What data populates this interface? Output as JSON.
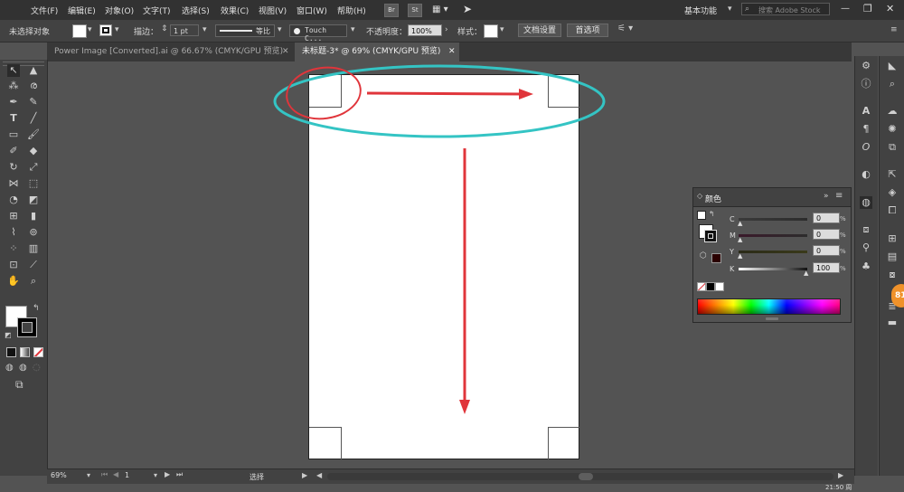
{
  "menu": [
    "文件(F)",
    "编辑(E)",
    "对象(O)",
    "文字(T)",
    "选择(S)",
    "效果(C)",
    "视图(V)",
    "窗口(W)",
    "帮助(H)"
  ],
  "menu_apps": [
    "Br",
    "St"
  ],
  "workspace": "基本功能",
  "search_placeholder": "搜索 Adobe Stock",
  "control": {
    "no_selection": "未选择对象",
    "stroke_label": "描边：",
    "stroke_value": "1 pt",
    "line_profile": "等比",
    "brush": "Touch C...",
    "opacity_label": "不透明度：",
    "opacity_value": "100%",
    "style_label": "样式：",
    "doc_setup": "文档设置",
    "preferences": "首选项"
  },
  "tabs": [
    {
      "label": "Power Image [Converted].ai @ 66.67% (CMYK/GPU 预览)",
      "close": "✕"
    },
    {
      "label": "未标题-3* @ 69% (CMYK/GPU 预览)",
      "close": "✕"
    }
  ],
  "status": {
    "zoom": "69%",
    "artboard": "1",
    "tool": "选择",
    "coords": "21:50 周"
  },
  "color_panel": {
    "title": "颜色",
    "channels": [
      {
        "label": "C",
        "value": "0",
        "unit": "%"
      },
      {
        "label": "M",
        "value": "0",
        "unit": "%"
      },
      {
        "label": "Y",
        "value": "0",
        "unit": "%"
      },
      {
        "label": "K",
        "value": "100",
        "unit": "%"
      }
    ]
  },
  "badge": "81",
  "colors": {
    "annotation_red": "#e0353b",
    "annotation_teal": "#34c4c4",
    "app_bg": "#535353"
  }
}
